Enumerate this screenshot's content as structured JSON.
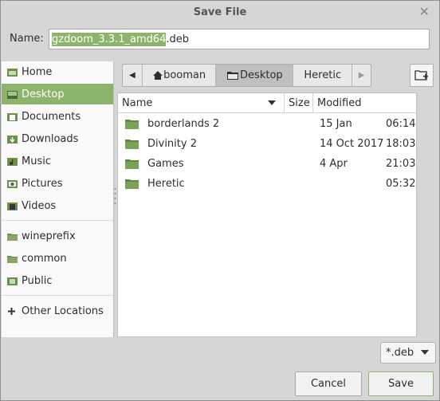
{
  "window": {
    "title": "Save File",
    "close_glyph": "✕"
  },
  "name_field": {
    "label": "Name:",
    "selected_part": "gzdoom_3.3.1_amd64",
    "extension_part": ".deb"
  },
  "sidebar": {
    "items": [
      {
        "label": "Home",
        "icon": "home-icon"
      },
      {
        "label": "Desktop",
        "icon": "desktop-icon",
        "active": true
      },
      {
        "label": "Documents",
        "icon": "documents-icon"
      },
      {
        "label": "Downloads",
        "icon": "downloads-icon"
      },
      {
        "label": "Music",
        "icon": "music-icon"
      },
      {
        "label": "Pictures",
        "icon": "pictures-icon"
      },
      {
        "label": "Videos",
        "icon": "videos-icon"
      },
      {
        "label": "wineprefix",
        "icon": "folder-icon"
      },
      {
        "label": "common",
        "icon": "folder-icon"
      },
      {
        "label": "Public",
        "icon": "public-icon"
      },
      {
        "label": "Other Locations",
        "icon": "plus-icon"
      }
    ]
  },
  "pathbar": {
    "left_arrow": "◀",
    "right_arrow": "▶",
    "crumbs": [
      {
        "label": "booman",
        "icon": "home-icon"
      },
      {
        "label": "Desktop",
        "icon": "folder-open-icon",
        "active": true
      },
      {
        "label": "Heretic"
      }
    ]
  },
  "filelist": {
    "columns": {
      "name": "Name",
      "size": "Size",
      "modified": "Modified"
    },
    "rows": [
      {
        "name": "borderlands 2",
        "date": "15 Jan",
        "time": "06:14"
      },
      {
        "name": "Divinity 2",
        "date": "14 Oct 2017",
        "time": "18:03"
      },
      {
        "name": "Games",
        "date": "4 Apr",
        "time": "21:03"
      },
      {
        "name": "Heretic",
        "date": "",
        "time": "05:32"
      }
    ]
  },
  "filter": {
    "value": "*.deb"
  },
  "buttons": {
    "cancel": "Cancel",
    "save": "Save"
  },
  "colors": {
    "accent": "#8cb46a",
    "folder": "#7aa35a",
    "background": "#d6d6d6"
  }
}
